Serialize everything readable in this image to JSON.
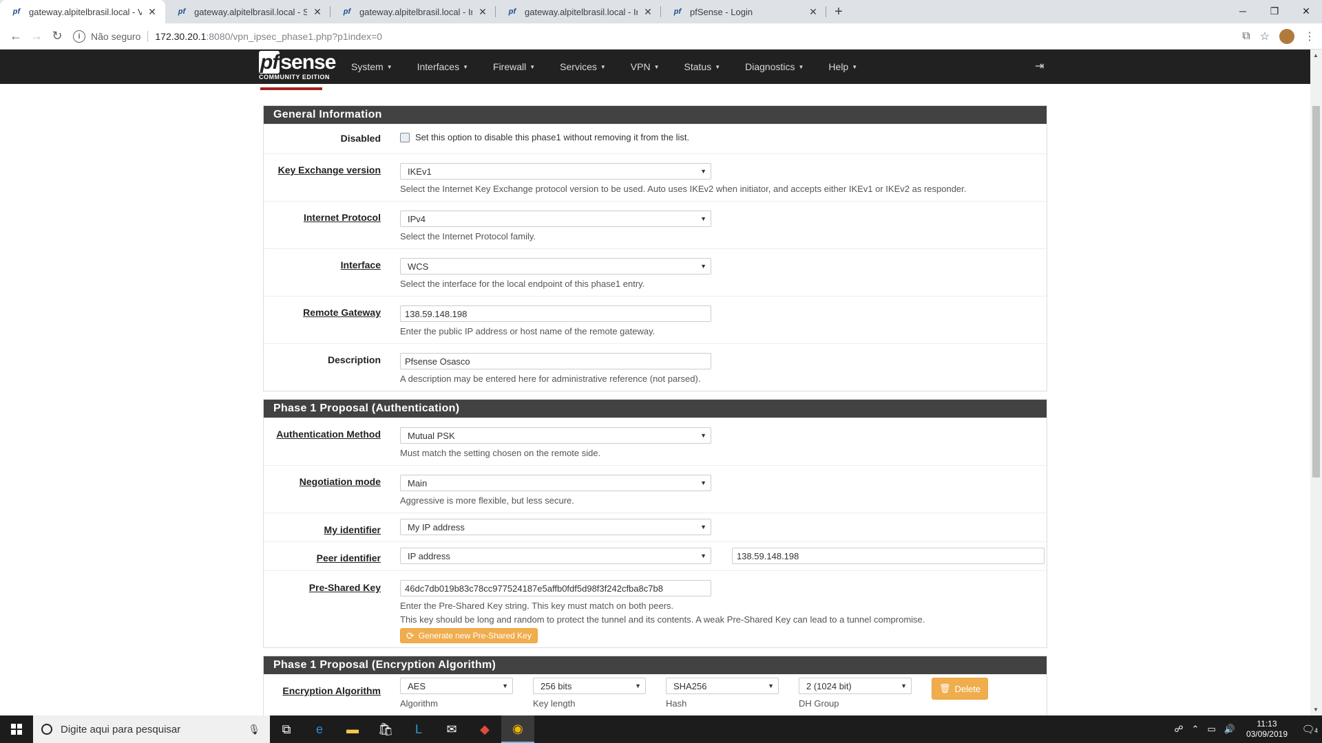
{
  "browser": {
    "tabs": [
      {
        "title": "gateway.alpitelbrasil.local - VPN:",
        "active": true
      },
      {
        "title": "gateway.alpitelbrasil.local - Status",
        "active": false
      },
      {
        "title": "gateway.alpitelbrasil.local - Interf",
        "active": false
      },
      {
        "title": "gateway.alpitelbrasil.local - Interf",
        "active": false
      },
      {
        "title": "pfSense - Login",
        "active": false
      }
    ],
    "new_tab": "+",
    "security_text": "Não seguro",
    "url_host": "172.30.20.1",
    "url_path": ":8080/vpn_ipsec_phase1.php?p1index=0"
  },
  "navbar": {
    "brand_logo_pf": "pf",
    "brand_logo_rest": "sense",
    "brand_edition": "COMMUNITY EDITION",
    "menu": [
      "System",
      "Interfaces",
      "Firewall",
      "Services",
      "VPN",
      "Status",
      "Diagnostics",
      "Help"
    ]
  },
  "general": {
    "title": "General Information",
    "disabled_label": "Disabled",
    "disabled_text": "Set this option to disable this phase1 without removing it from the list.",
    "kex_label": "Key Exchange version",
    "kex_value": "IKEv1",
    "kex_help": "Select the Internet Key Exchange protocol version to be used. Auto uses IKEv2 when initiator, and accepts either IKEv1 or IKEv2 as responder.",
    "proto_label": "Internet Protocol",
    "proto_value": "IPv4",
    "proto_help": "Select the Internet Protocol family.",
    "iface_label": "Interface",
    "iface_value": "WCS",
    "iface_help": "Select the interface for the local endpoint of this phase1 entry.",
    "gw_label": "Remote Gateway",
    "gw_value": "138.59.148.198",
    "gw_help": "Enter the public IP address or host name of the remote gateway.",
    "desc_label": "Description",
    "desc_value": "Pfsense Osasco",
    "desc_help": "A description may be entered here for administrative reference (not parsed)."
  },
  "auth": {
    "title": "Phase 1 Proposal (Authentication)",
    "method_label": "Authentication Method",
    "method_value": "Mutual PSK",
    "method_help": "Must match the setting chosen on the remote side.",
    "neg_label": "Negotiation mode",
    "neg_value": "Main",
    "neg_help": "Aggressive is more flexible, but less secure.",
    "myid_label": "My identifier",
    "myid_value": "My IP address",
    "peerid_label": "Peer identifier",
    "peerid_value": "IP address",
    "peerid_input": "138.59.148.198",
    "psk_label": "Pre-Shared Key",
    "psk_value": "46dc7db019b83c78cc977524187e5affb0fdf5d98f3f242cfba8c7b8",
    "psk_help1": "Enter the Pre-Shared Key string. This key must match on both peers.",
    "psk_help2": "This key should be long and random to protect the tunnel and its contents. A weak Pre-Shared Key can lead to a tunnel compromise.",
    "psk_button": "Generate new Pre-Shared Key"
  },
  "enc": {
    "title": "Phase 1 Proposal (Encryption Algorithm)",
    "label": "Encryption Algorithm",
    "algorithm": "AES",
    "algorithm_label": "Algorithm",
    "keylen": "256 bits",
    "keylen_label": "Key length",
    "hash": "SHA256",
    "hash_label": "Hash",
    "dh": "2 (1024 bit)",
    "dh_label": "DH Group",
    "delete": "Delete"
  },
  "taskbar": {
    "search_placeholder": "Digite aqui para pesquisar",
    "time": "11:13",
    "date": "03/09/2019",
    "notif_count": "4"
  }
}
